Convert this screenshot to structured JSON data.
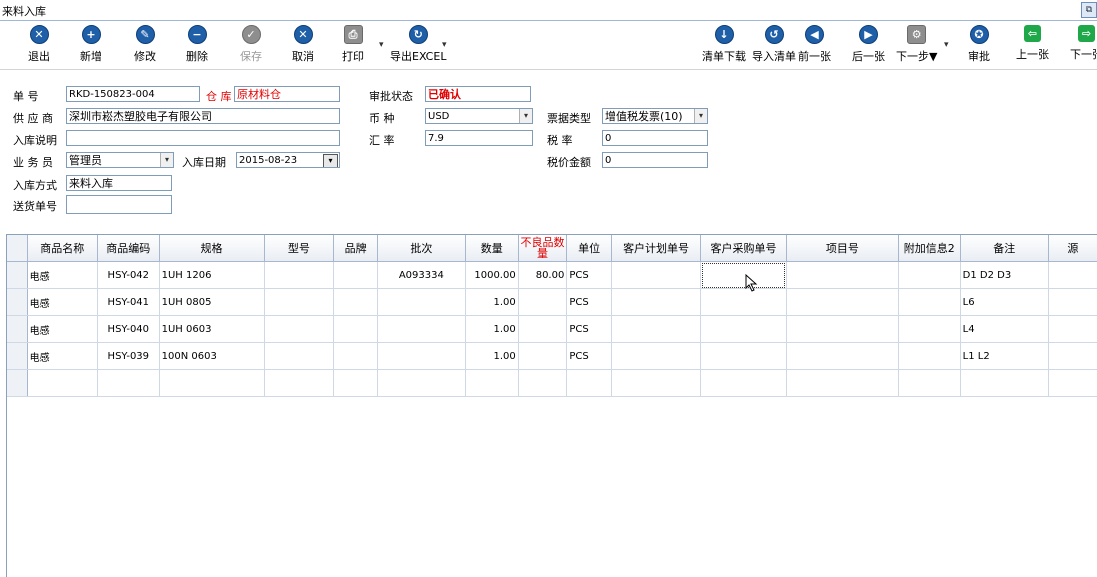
{
  "window": {
    "title": "来料入库",
    "restore_glyph": "⧉"
  },
  "toolbar": {
    "left": [
      {
        "label": "退出",
        "icon": "exit-icon",
        "glyph": "✕"
      },
      {
        "label": "新增",
        "icon": "plus-icon",
        "glyph": "+"
      },
      {
        "label": "修改",
        "icon": "edit-icon",
        "glyph": "✎"
      },
      {
        "label": "删除",
        "icon": "minus-icon",
        "glyph": "−"
      },
      {
        "label": "保存",
        "icon": "check-icon",
        "glyph": "✓"
      },
      {
        "label": "取消",
        "icon": "cancel-icon",
        "glyph": "✕"
      },
      {
        "label": "打印",
        "icon": "printer-icon",
        "glyph": "⎙"
      },
      {
        "label": "导出EXCEL",
        "icon": "export-icon",
        "glyph": "↻"
      }
    ],
    "right": [
      {
        "label": "清单下载",
        "icon": "download-icon",
        "glyph": "↓"
      },
      {
        "label": "导入清单",
        "icon": "import-icon",
        "glyph": "↺"
      },
      {
        "label": "前一张",
        "icon": "arrow-left-icon",
        "glyph": "◀"
      },
      {
        "label": "后一张",
        "icon": "arrow-right-icon",
        "glyph": "▶"
      },
      {
        "label": "下一步▼",
        "icon": "next-step-icon",
        "glyph": "⚙"
      },
      {
        "label": "审批",
        "icon": "approve-icon",
        "glyph": "✪"
      },
      {
        "label": "上一张",
        "icon": "prev-icon",
        "glyph": "⇦"
      },
      {
        "label": "下一张",
        "icon": "next-icon",
        "glyph": "⇨"
      }
    ],
    "caret": "▾"
  },
  "form": {
    "doc_no_label": "单  号",
    "doc_no": "RKD-150823-004",
    "warehouse_label": "仓 库",
    "warehouse": "原材料仓",
    "approval_label": "审批状态",
    "approval": "已确认",
    "supplier_label": "供 应 商",
    "supplier": "深圳市崧杰塑胶电子有限公司",
    "currency_label": "币  种",
    "currency": "USD",
    "invoice_type_label": "票据类型",
    "invoice_type": "增值税发票(10)",
    "remark_label": "入库说明",
    "remark": "",
    "rate_label": "汇  率",
    "rate": "7.9",
    "tax_label": "税  率",
    "tax": "0",
    "clerk_label": "业 务 员",
    "clerk": "管理员",
    "date_label": "入库日期",
    "date": "2015-08-23",
    "tax_amount_label": "税价金额",
    "tax_amount": "0",
    "method_label": "入库方式",
    "method": "来料入库",
    "delivery_label": "送货单号",
    "delivery": "",
    "dropdown_glyph": "▾"
  },
  "grid": {
    "headers": [
      "商品名称",
      "商品编码",
      "规格",
      "型号",
      "品牌",
      "批次",
      "数量",
      "不良品数量",
      "单位",
      "客户计划单号",
      "客户采购单号",
      "项目号",
      "附加信息2",
      "备注",
      "源"
    ],
    "rows": [
      [
        "电感",
        "HSY-042",
        "1UH  1206",
        "",
        "",
        "A093334",
        "1000.00",
        "80.00",
        "PCS",
        "",
        "",
        "",
        "",
        "D1 D2 D3",
        ""
      ],
      [
        "电感",
        "HSY-041",
        "1UH  0805",
        "",
        "",
        "",
        "1.00",
        "",
        "PCS",
        "",
        "",
        "",
        "",
        "L6",
        ""
      ],
      [
        "电感",
        "HSY-040",
        "1UH  0603",
        "",
        "",
        "",
        "1.00",
        "",
        "PCS",
        "",
        "",
        "",
        "",
        "L4",
        ""
      ],
      [
        "电感",
        "HSY-039",
        "100N  0603",
        "",
        "",
        "",
        "1.00",
        "",
        "PCS",
        "",
        "",
        "",
        "",
        "L1 L2",
        ""
      ]
    ]
  },
  "colors": {
    "accent": "#1e5fa8",
    "red": "#e00000"
  }
}
